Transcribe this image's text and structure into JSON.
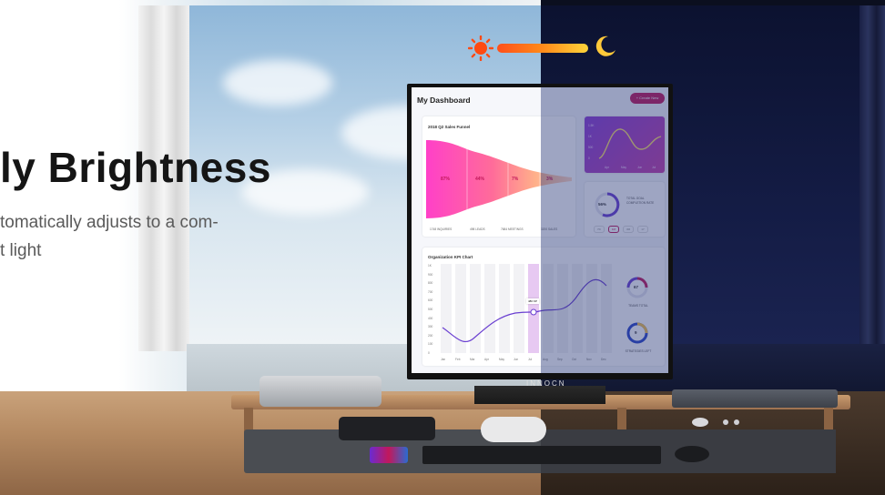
{
  "hero": {
    "headline": "ly Brightness",
    "subtext_line1": "tomatically adjusts to a com-",
    "subtext_line2": "t light"
  },
  "brightness_slider": {
    "left_icon": "sun-icon",
    "right_icon": "moon-icon",
    "colors": [
      "#ff4f1a",
      "#ffd43a"
    ]
  },
  "monitor": {
    "brand": "INNOCN"
  },
  "dashboard": {
    "title": "My Dashboard",
    "create_button": "+ Create New",
    "funnel": {
      "title": "2018 Q2 Sales Funnel",
      "stages": [
        {
          "pct": "87%",
          "label": "1748 INQUIRIES"
        },
        {
          "pct": "44%",
          "label": "498 LEADS"
        },
        {
          "pct": "7%",
          "label": "7684 MEETINGS"
        },
        {
          "pct": "3%",
          "label": "3200 SALES"
        }
      ]
    },
    "mini_chart": {
      "ticks": [
        "1.5K",
        "1K",
        "500",
        "250",
        "0"
      ],
      "months": [
        "Apr",
        "May",
        "Jun",
        "Jul"
      ]
    },
    "goal": {
      "pct": "56%",
      "label": "TOTAL GOAL COMPLETION RATE",
      "pills": [
        "7D",
        "1M",
        "3M",
        "1Y"
      ]
    },
    "kpi": {
      "title": "Organization KPI Chart",
      "tooltip": "480 KP",
      "yticks": [
        "1K",
        "900",
        "800",
        "700",
        "600",
        "500",
        "400",
        "300",
        "200",
        "100",
        "0"
      ],
      "months": [
        "Jan",
        "Feb",
        "Mar",
        "Apr",
        "May",
        "Jun",
        "Jul",
        "Aug",
        "Sep",
        "Oct",
        "Nov",
        "Dec"
      ],
      "teams_value": "67",
      "teams_label": "TEAMS TOTAL",
      "strategies_value": "9",
      "strategies_label": "STRATEGIES LEFT"
    }
  },
  "colors": {
    "accent": "#c2185b",
    "night": "#0b0f1f",
    "purple": "#6a3fd1"
  }
}
